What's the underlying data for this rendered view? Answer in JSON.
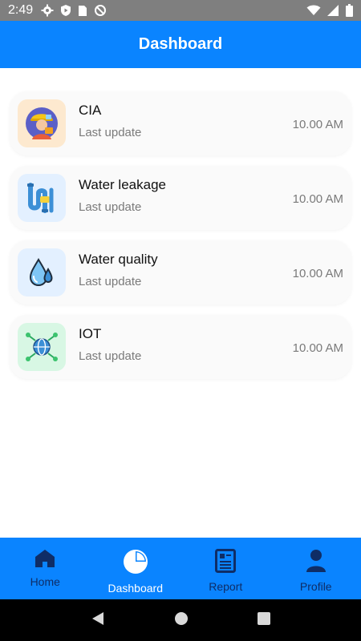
{
  "status_bar": {
    "time": "2:49",
    "icons": [
      "gear-icon",
      "shield-icon",
      "sim-card-icon",
      "at-sign-icon",
      "wifi-icon",
      "signal-icon",
      "battery-icon"
    ]
  },
  "app_bar": {
    "title": "Dashboard"
  },
  "items": [
    {
      "name": "CIA",
      "subtitle": "Last update",
      "time": "10.00 AM",
      "icon": "worker-icon",
      "tile_color": "#fde9cf"
    },
    {
      "name": "Water leakage",
      "subtitle": "Last update",
      "time": "10.00 AM",
      "icon": "pipe-icon",
      "tile_color": "#e3f0ff"
    },
    {
      "name": "Water quality",
      "subtitle": "Last update",
      "time": "10.00 AM",
      "icon": "water-drop-icon",
      "tile_color": "#e3f0ff"
    },
    {
      "name": "IOT",
      "subtitle": "Last update",
      "time": "10.00 AM",
      "icon": "iot-globe-icon",
      "tile_color": "#d8f7e4"
    }
  ],
  "bottom_nav": {
    "active": "Dashboard",
    "items": [
      {
        "label": "Home",
        "icon": "home-icon"
      },
      {
        "label": "Dashboard",
        "icon": "pie-chart-icon"
      },
      {
        "label": "Report",
        "icon": "report-icon"
      },
      {
        "label": "Profile",
        "icon": "profile-icon"
      }
    ]
  },
  "system_nav": {
    "icons": [
      "back-icon",
      "home-circle-icon",
      "recents-icon"
    ]
  },
  "colors": {
    "primary": "#0a84ff",
    "nav_inactive": "#0f2d66",
    "status_bar": "#7f7f7f"
  }
}
